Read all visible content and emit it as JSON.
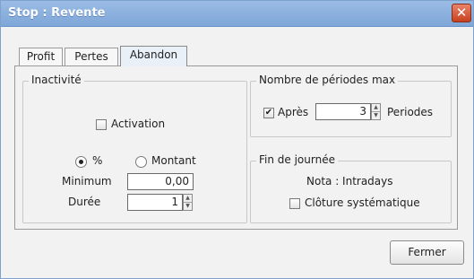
{
  "window": {
    "title": "Stop : Revente",
    "close_icon": "close-icon"
  },
  "tabs": [
    {
      "label": "Profit"
    },
    {
      "label": "Pertes"
    },
    {
      "label": "Abandon",
      "active": true
    }
  ],
  "inactivite": {
    "legend": "Inactivité",
    "activation_label": "Activation",
    "activation_checked": false,
    "radio_percent_label": "%",
    "radio_montant_label": "Montant",
    "selected": "%",
    "minimum_label": "Minimum",
    "minimum_value": "0,00",
    "duree_label": "Durée",
    "duree_value": "1"
  },
  "periodes": {
    "legend": "Nombre de périodes max",
    "apres_label": "Après",
    "apres_checked": true,
    "apres_value": "3",
    "periodes_label": "Periodes"
  },
  "fin": {
    "legend": "Fin de journée",
    "nota": "Nota : Intradays",
    "cloture_label": "Clôture systématique",
    "cloture_checked": false
  },
  "footer": {
    "close_button": "Fermer"
  }
}
